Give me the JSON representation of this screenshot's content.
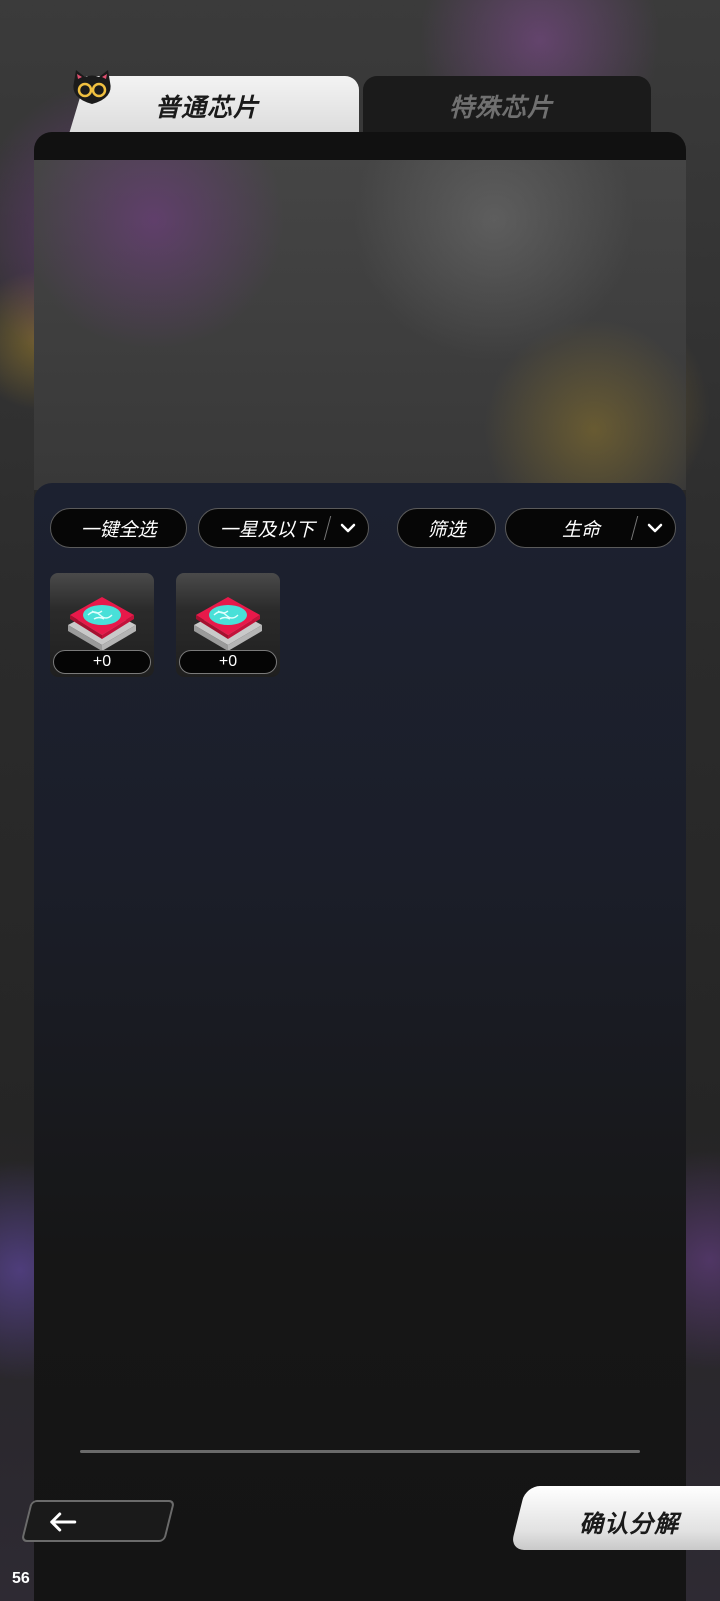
{
  "tabs": {
    "normal_label": "普通芯片",
    "special_label": "特殊芯片",
    "active": "normal"
  },
  "filters": {
    "select_all_label": "一键全选",
    "rarity_label": "一星及以下",
    "filter_label": "筛选",
    "stat_label": "生命"
  },
  "chips": [
    {
      "level": "+0",
      "icon": "chip-icon"
    },
    {
      "level": "+0",
      "icon": "chip-icon"
    }
  ],
  "footer": {
    "confirm_label": "确认分解",
    "back_icon": "arrow-left-icon"
  },
  "fps": "56",
  "colors": {
    "chip_red": "#e8194a",
    "chip_cyan": "#49e0d8",
    "active_tab": "#f0f0f0",
    "inactive_tab_text": "#707070"
  }
}
